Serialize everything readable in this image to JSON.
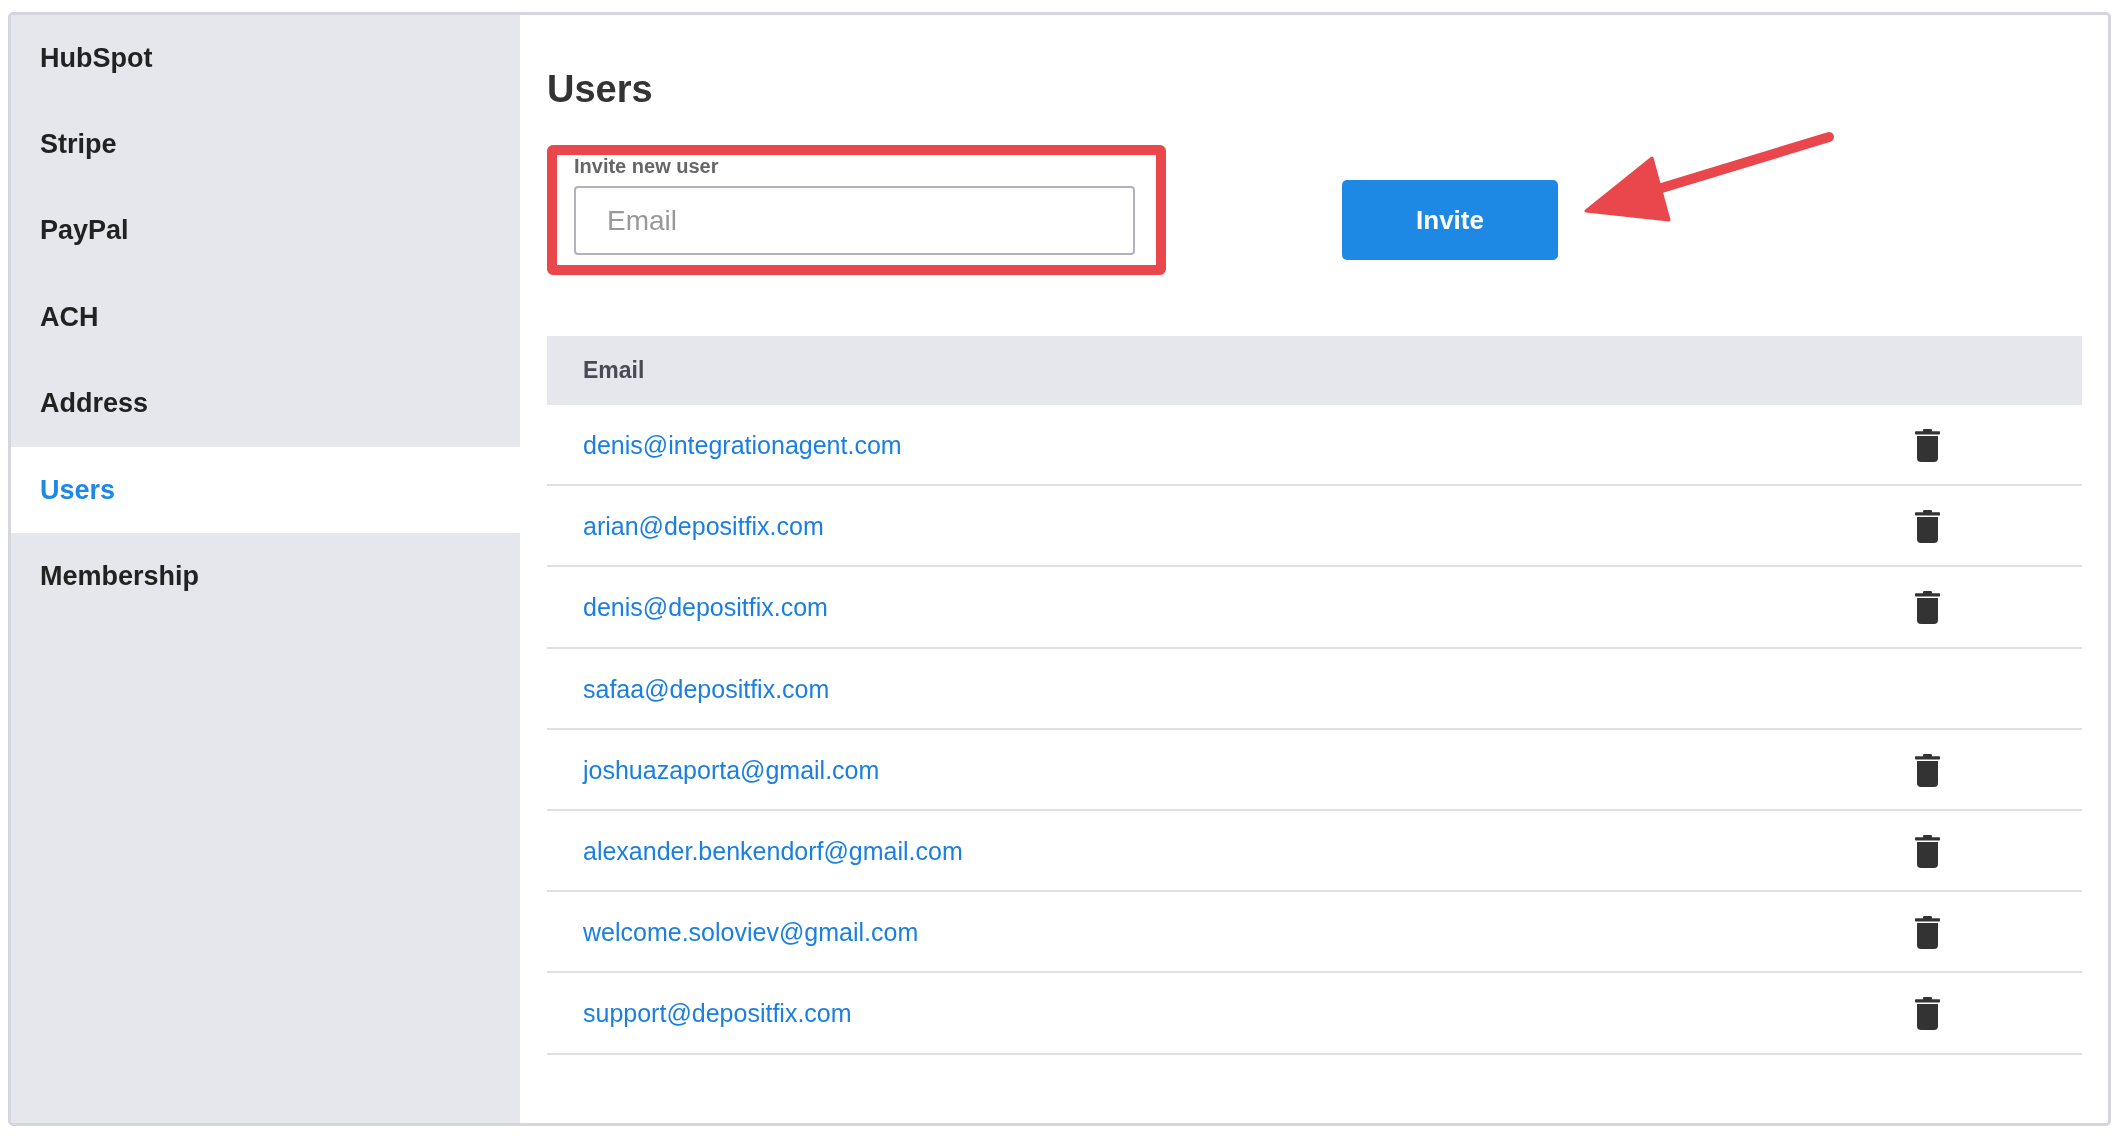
{
  "sidebar": {
    "items": [
      {
        "label": "HubSpot",
        "selected": false
      },
      {
        "label": "Stripe",
        "selected": false
      },
      {
        "label": "PayPal",
        "selected": false
      },
      {
        "label": "ACH",
        "selected": false
      },
      {
        "label": "Address",
        "selected": false
      },
      {
        "label": "Users",
        "selected": true
      },
      {
        "label": "Membership",
        "selected": false
      }
    ]
  },
  "page_title": "Users",
  "invite": {
    "label": "Invite new user",
    "email_field": {
      "placeholder": "Email"
    },
    "button": "Invite"
  },
  "table": {
    "columns": [
      "Email"
    ],
    "rows": [
      {
        "email": "denis@integrationagent.com",
        "deletable": true
      },
      {
        "email": "arian@depositfix.com",
        "deletable": true
      },
      {
        "email": "denis@depositfix.com",
        "deletable": true
      },
      {
        "email": "safaa@depositfix.com",
        "deletable": false
      },
      {
        "email": "joshuazaporta@gmail.com",
        "deletable": true
      },
      {
        "email": "alexander.benkendorf@gmail.com",
        "deletable": true
      },
      {
        "email": "welcome.soloviev@gmail.com",
        "deletable": true
      },
      {
        "email": "support@depositfix.com",
        "deletable": true
      }
    ]
  }
}
